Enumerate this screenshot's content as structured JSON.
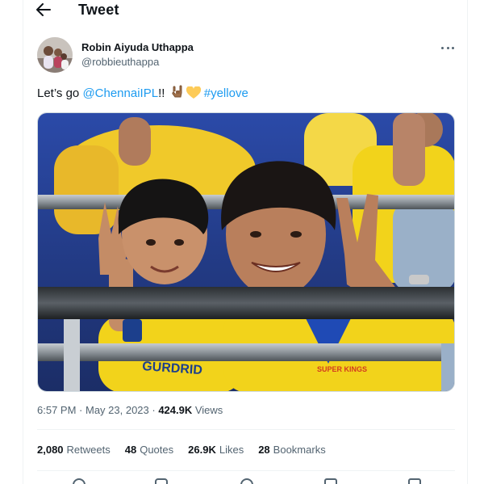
{
  "header": {
    "title": "Tweet"
  },
  "author": {
    "display_name": "Robin Aiyuda Uthappa",
    "handle": "@robbieuthappa"
  },
  "tweet": {
    "text_prefix": "Let’s go ",
    "mention": "@ChennaiIPL",
    "exclaim": "!! ",
    "hashtag": "#yellove",
    "emojis": [
      "horns-hand-emoji",
      "yellow-heart-emoji"
    ]
  },
  "media": {
    "jersey_text_1": "GURDRID",
    "jersey_text_2": "SUPER KINGS"
  },
  "meta": {
    "time": "6:57 PM",
    "sep": " · ",
    "date": "May 23, 2023",
    "views_count": "424.9K",
    "views_label": " Views"
  },
  "stats": [
    {
      "count": "2,080",
      "label": "Retweets"
    },
    {
      "count": "48",
      "label": "Quotes"
    },
    {
      "count": "26.9K",
      "label": "Likes"
    },
    {
      "count": "28",
      "label": "Bookmarks"
    }
  ],
  "colors": {
    "link": "#1d9bf0",
    "secondary": "#536471",
    "primary": "#0f1419",
    "border": "#eff3f4",
    "csk_yellow": "#f2d31b"
  },
  "icons": [
    "back-arrow-icon",
    "more-icon",
    "reply-icon",
    "retweet-icon",
    "like-icon",
    "bookmark-icon",
    "share-icon"
  ]
}
